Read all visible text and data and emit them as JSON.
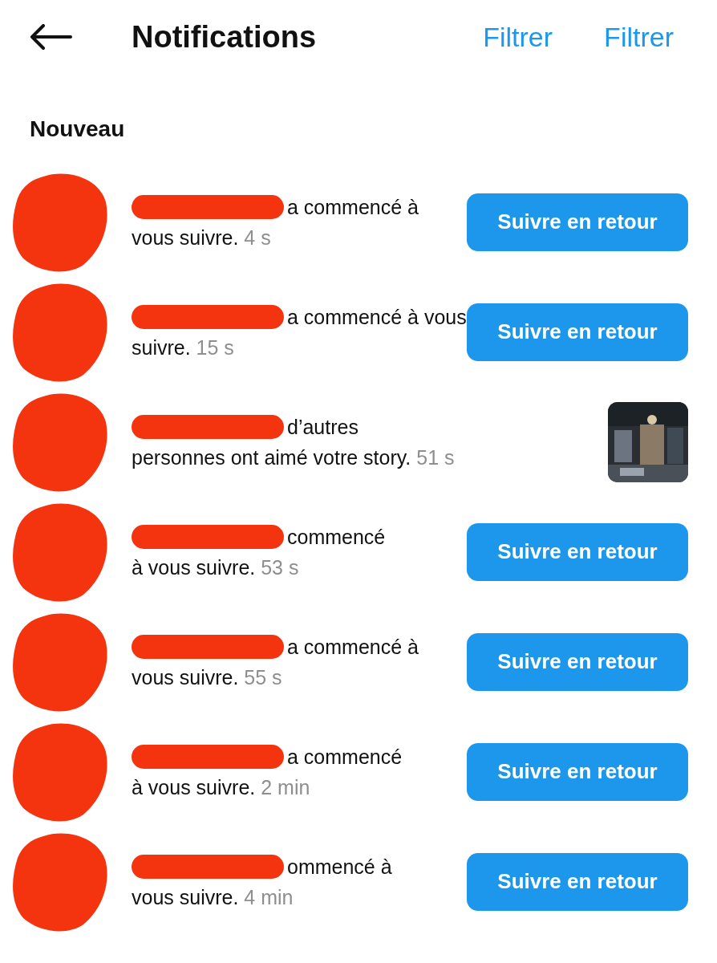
{
  "header": {
    "title": "Notifications",
    "actions": [
      "Filtrer",
      "Filtrer"
    ]
  },
  "section": "Nouveau",
  "rows": [
    {
      "kind": "follow",
      "line1": "a commencé à",
      "line2": "vous suivre.",
      "time": "4 s",
      "button": "Suivre en retour"
    },
    {
      "kind": "follow",
      "line1": "a commencé à vous",
      "line2": "suivre.",
      "time": "15 s",
      "button": "Suivre en retour"
    },
    {
      "kind": "like",
      "line1": "d’autres",
      "line2": "personnes ont aimé votre story.",
      "time": "51 s"
    },
    {
      "kind": "follow",
      "line1": "commencé",
      "line2": "à vous suivre.",
      "time": "53 s",
      "button": "Suivre en retour"
    },
    {
      "kind": "follow",
      "line1": "a commencé à",
      "line2": "vous suivre.",
      "time": "55 s",
      "button": "Suivre en retour"
    },
    {
      "kind": "follow",
      "line1": "a commencé",
      "line2": "à vous suivre.",
      "time": "2 min",
      "button": "Suivre en retour"
    },
    {
      "kind": "follow",
      "line1": "ommencé à",
      "line2": "vous suivre.",
      "time": "4 min",
      "button": "Suivre en retour"
    }
  ]
}
